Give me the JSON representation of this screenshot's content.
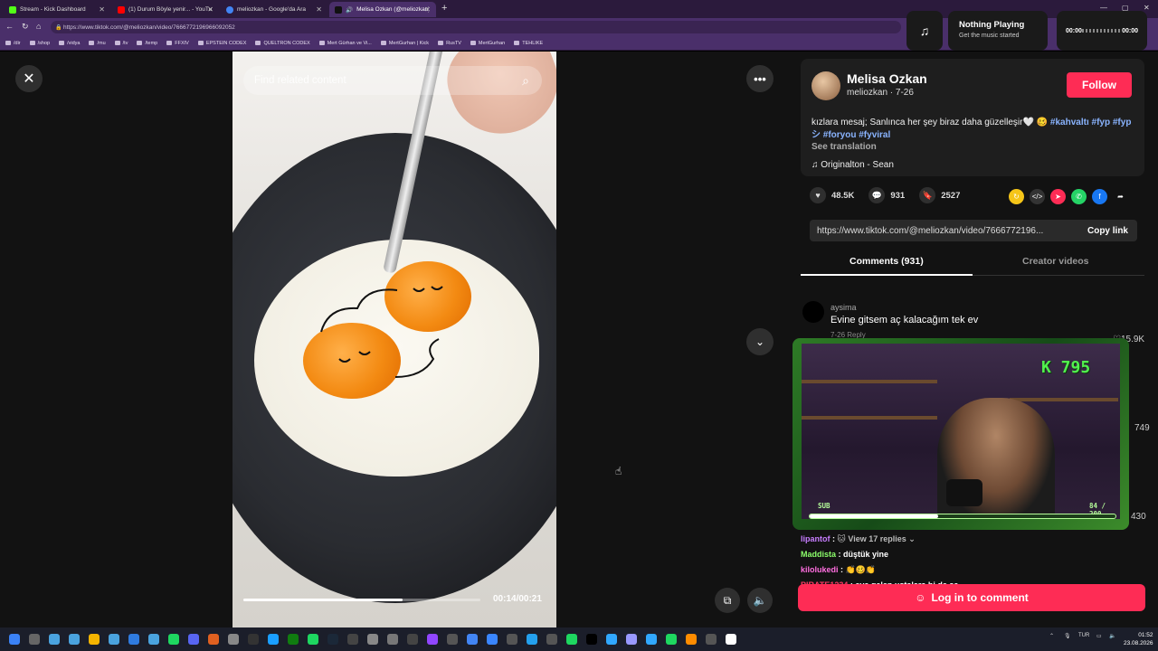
{
  "browser": {
    "tabs": [
      {
        "label": "Stream - Kick Dashboard",
        "color": "#53fc18"
      },
      {
        "label": "(1) Durum Böyle yenir... - YouTube",
        "color": "#ff0000"
      },
      {
        "label": "meliozkan - Google'da Ara",
        "color": "#4285f4"
      },
      {
        "label": "Melisa Ozkan (@meliozkan) |",
        "color": "#222222"
      }
    ],
    "url": "https://www.tiktok.com/@meliozkan/video/7666772196966092052",
    "bookmarks": [
      "/dir",
      "/shop",
      "/vidya",
      "/mu",
      "/tv",
      "/temp",
      "FFXIV",
      "EPSTEIN CODEX",
      "QUELTRON CODEX",
      "Mert Gürhan ve Vi...",
      "MertGurhan | Kick",
      "RusTV",
      "MertGurhan",
      "TEHLIKE"
    ]
  },
  "now_playing": {
    "title": "Nothing Playing",
    "subtitle": "Get the music started",
    "time_start": "00:00",
    "time_end": "00:00"
  },
  "video": {
    "search_placeholder": "Find related content",
    "time": "00:14/00:21",
    "progress_fraction": 0.67
  },
  "post": {
    "author": "Melisa Ozkan",
    "handle": "meliozkan · 7-26",
    "follow_label": "Follow",
    "caption": "kızlara mesaj; Sanlınca her şey biraz daha güzelleşir🤍 🥴",
    "tags": [
      "#kahvaltı",
      "#fyp",
      "#fypシ",
      "#foryou",
      "#fyviral"
    ],
    "see_translation": "See translation",
    "music": "Originalton - Sean",
    "likes": "48.5K",
    "comments": "931",
    "saves": "2527",
    "link": "https://www.tiktok.com/@meliozkan/video/7666772196...",
    "copy_label": "Copy link"
  },
  "comments_tabs": {
    "comments": "Comments (931)",
    "creator": "Creator videos"
  },
  "comment1": {
    "user": "aysima",
    "text": "Evine gitsem aç kalacağım tek ev",
    "meta": "7-26   Reply",
    "likes": "15.9K"
  },
  "side_counts": [
    "749",
    "430"
  ],
  "stream": {
    "kick_badge": "K 795",
    "sub_label": "SUB",
    "sub_count": "84 / 200",
    "sub_fraction": 0.42
  },
  "chat": [
    {
      "user": "lipantof",
      "text": "🐱 View 17 replies ⌄"
    },
    {
      "user": "Maddista",
      "text": "düştük yine"
    },
    {
      "user": "kilolukedi",
      "text": "👏🥴👏"
    },
    {
      "user": "PIRATE1234",
      "text": "eve gelen ustalara bi de sa"
    }
  ],
  "login_label": "Log in to comment",
  "clock": {
    "time": "01:52",
    "date": "23.08.2026"
  },
  "tray_lang": "TUR"
}
